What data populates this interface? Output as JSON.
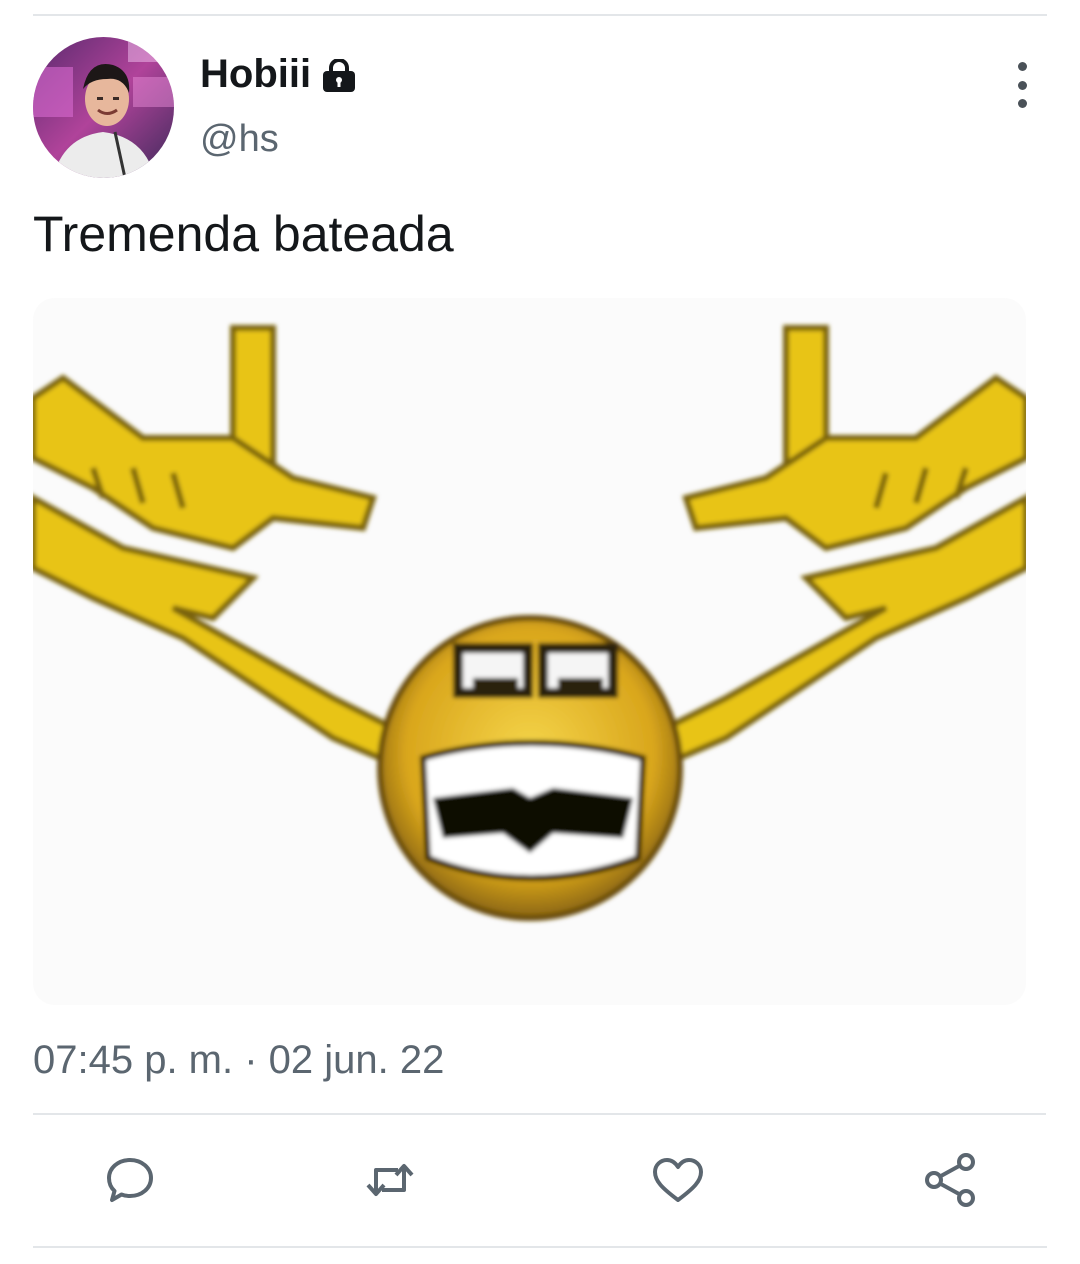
{
  "tweet": {
    "display_name": "Hobiii",
    "handle": "@hs",
    "text": "Tremenda bateada",
    "timestamp": "07:45 p. m. · 02 jun. 22",
    "protected_icon": "lock-icon",
    "avatar": "profile-photo"
  },
  "media": {
    "description_icon": "emoji-face-with-hand-signs"
  },
  "actions": [
    {
      "name": "reply",
      "icon": "comment-bubble-icon"
    },
    {
      "name": "retweet",
      "icon": "retweet-icon"
    },
    {
      "name": "like",
      "icon": "heart-icon"
    },
    {
      "name": "share",
      "icon": "share-icon"
    }
  ],
  "colors": {
    "text": "#14171a",
    "secondary_text": "#5b6670",
    "divider": "#e3e6e9",
    "emoji_yellow": "#e8c417"
  }
}
